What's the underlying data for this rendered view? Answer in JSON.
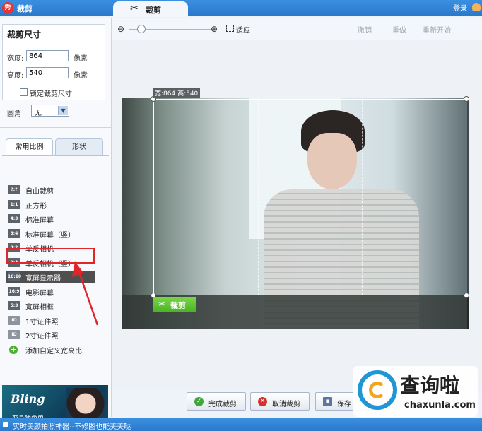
{
  "titlebar": {
    "app_logo": "秀",
    "title": "裁剪",
    "tab_label": "裁剪",
    "login": "登录"
  },
  "size_panel": {
    "title": "裁剪尺寸",
    "width_label": "宽度:",
    "width_value": "864",
    "width_unit": "像素",
    "height_label": "高度:",
    "height_value": "540",
    "height_unit": "像素",
    "lock_label": "锁定裁剪尺寸",
    "lock_checked": false,
    "corner_label": "圆角",
    "corner_value": "无"
  },
  "tabs": {
    "common": "常用比例",
    "shape": "形状"
  },
  "ratio_items": [
    {
      "icon": "?:?",
      "label": "自由裁剪"
    },
    {
      "icon": "1:1",
      "label": "正方形"
    },
    {
      "icon": "4:3",
      "label": "标准屏幕"
    },
    {
      "icon": "3:4",
      "label": "标准屏幕（竖）"
    },
    {
      "icon": "3:2",
      "label": "单反相机"
    },
    {
      "icon": "2:3",
      "label": "单反相机（竖）"
    },
    {
      "icon": "16:10",
      "label": "宽屏显示器",
      "selected": true
    },
    {
      "icon": "16:9",
      "label": "电影屏幕"
    },
    {
      "icon": "5:3",
      "label": "宽屏相框"
    },
    {
      "icon": "ID",
      "label": "1寸证件照"
    },
    {
      "icon": "ID",
      "label": "2寸证件照"
    },
    {
      "icon": "+",
      "label": "添加自定义宽高比"
    }
  ],
  "ad": {
    "text1": "Bling",
    "text2": "变身独角兽"
  },
  "toolbar": {
    "fit": "适应",
    "undo": "撤销",
    "redo": "重做",
    "restart": "重新开始"
  },
  "canvas": {
    "dimension_label": "宽:864 高:540",
    "crop_button": "裁剪"
  },
  "bottom": {
    "done": "完成裁剪",
    "cancel": "取消裁剪",
    "save": "保存"
  },
  "watermark": {
    "title": "查询啦",
    "domain": "chaxunla.com"
  },
  "statusbar": {
    "text": "实时美颜拍照神器--不修图也能美美哒"
  },
  "colors": {
    "titlebar": "#2c79cc",
    "selected_item": "#4f4f4f",
    "highlight": "#e1262a",
    "crop_button": "#4ab321"
  }
}
